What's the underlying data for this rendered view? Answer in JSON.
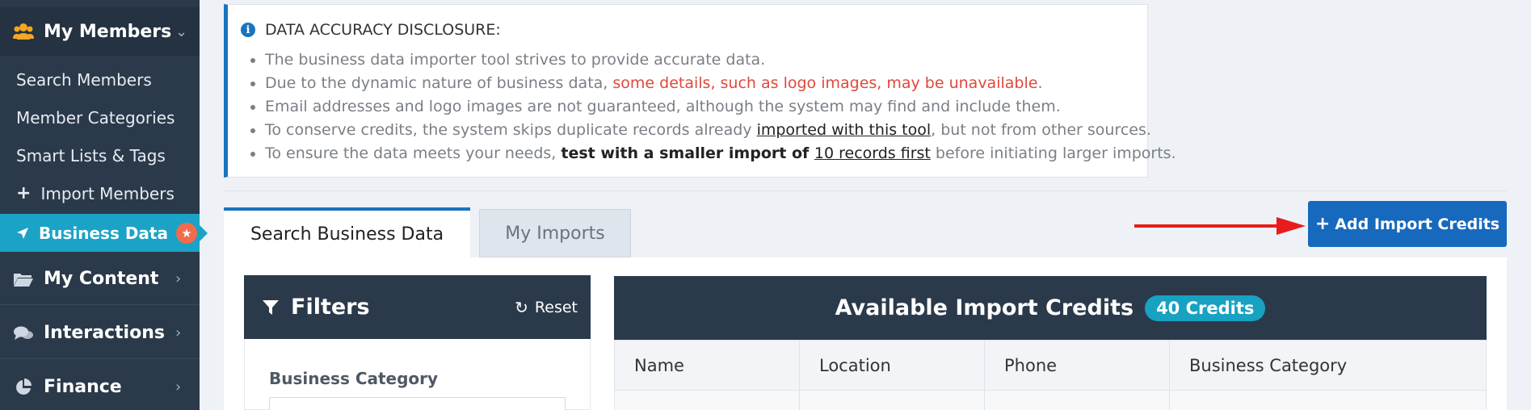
{
  "sidebar": {
    "members_label": "My Members",
    "sub_items": [
      {
        "label": "Search Members"
      },
      {
        "label": "Member Categories"
      },
      {
        "label": "Smart Lists & Tags"
      },
      {
        "label": "Import Members"
      },
      {
        "label": "Business Data"
      }
    ],
    "sections": [
      {
        "label": "My Content",
        "icon": "folder-icon"
      },
      {
        "label": "Interactions",
        "icon": "comments-icon"
      },
      {
        "label": "Finance",
        "icon": "pie-chart-icon"
      }
    ],
    "badge_icon": "star-icon",
    "active_color": "#1aa3c6"
  },
  "disclosure": {
    "title": "DATA ACCURACY DISCLOSURE:",
    "line1": "The business data importer tool strives to provide accurate data.",
    "line2_a": "Due to the dynamic nature of business data, ",
    "line2_red": "some details, such as logo images, may be unavailable",
    "line2_b": ".",
    "line3": "Email addresses and logo images are not guaranteed, although the system may find and include them.",
    "line4_a": "To conserve credits, the system skips duplicate records already ",
    "line4_link": "imported with this tool",
    "line4_b": ", but not from other sources.",
    "line5_a": "To ensure the data meets your needs, ",
    "line5_bold": "test with a smaller import of ",
    "line5_link": "10 records first",
    "line5_b": " before initiating larger imports."
  },
  "tabs": [
    {
      "label": "Search Business Data",
      "active": true
    },
    {
      "label": "My Imports",
      "active": false
    }
  ],
  "add_credits_button": "Add Import Credits",
  "filters": {
    "title": "Filters",
    "reset_label": "Reset",
    "business_category_label": "Business Category"
  },
  "credits": {
    "title": "Available Import Credits",
    "badge": "40 Credits",
    "columns": [
      "Name",
      "Location",
      "Phone",
      "Business Category"
    ]
  },
  "colors": {
    "primary": "#1769bd",
    "dark": "#2b3a4a",
    "accent": "#17a2c2",
    "warning": "#e0483b"
  }
}
